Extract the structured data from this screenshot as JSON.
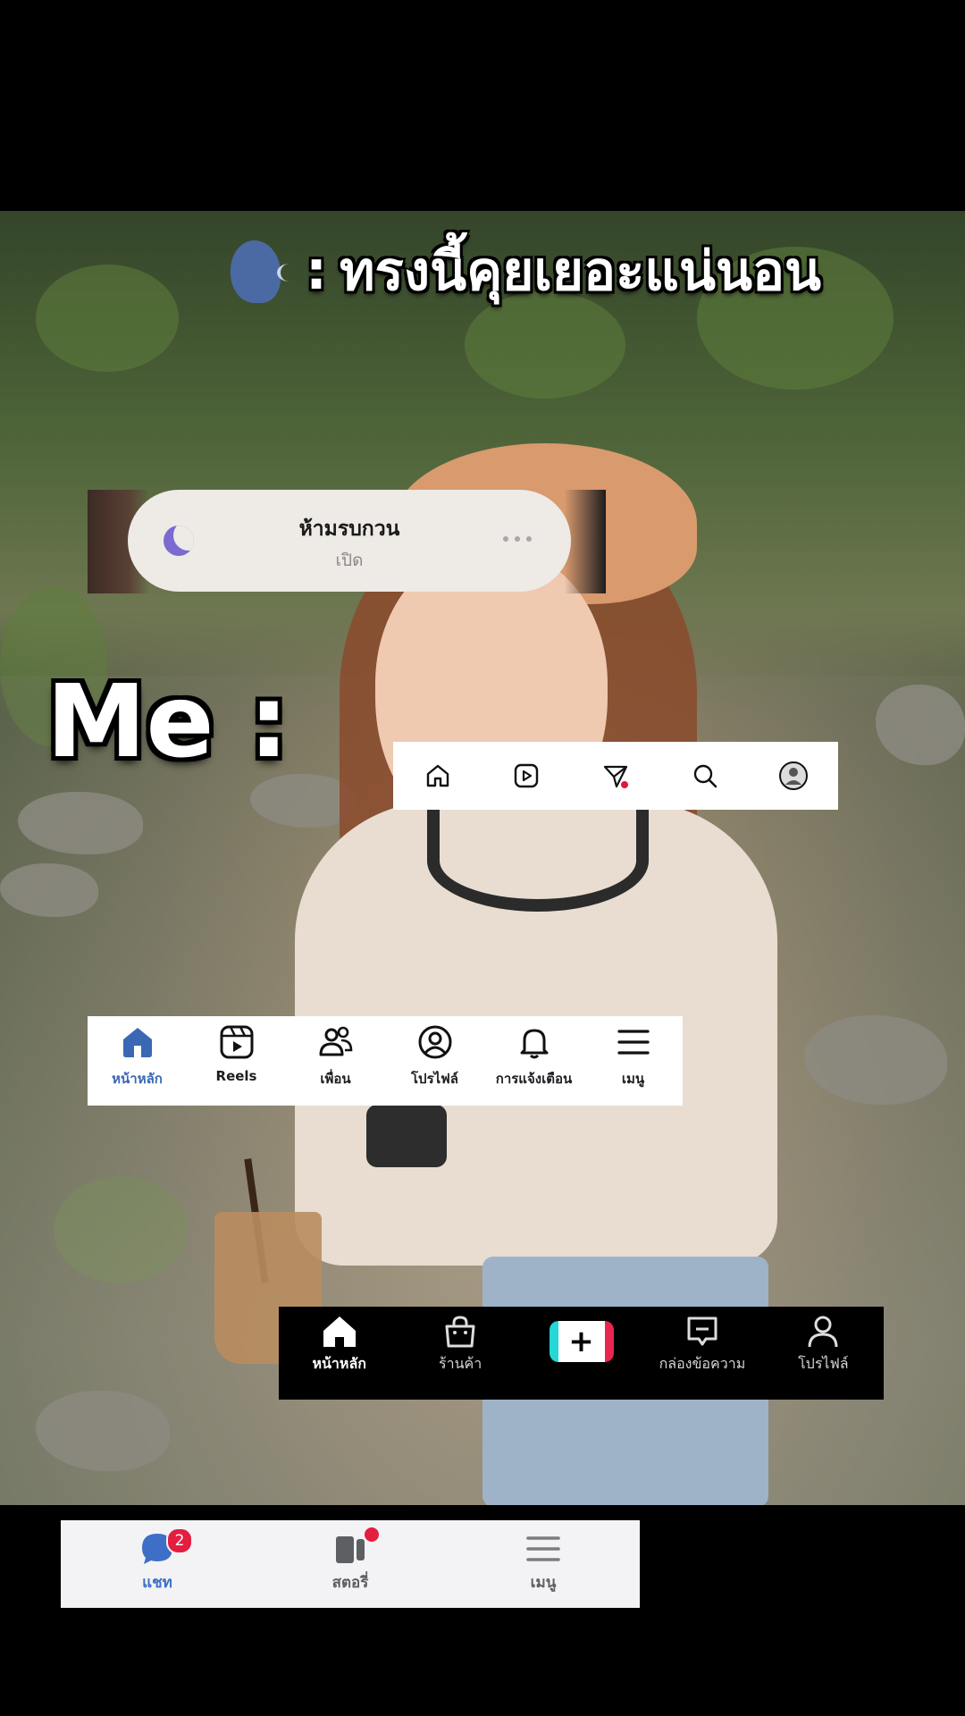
{
  "caption": {
    "text": "ทรงนี้คุยเยอะแน่นอน",
    "icon": "speaking-head-icon"
  },
  "me_label": "Me :",
  "dnd": {
    "title": "ห้ามรบกวน",
    "status": "เปิด",
    "icon": "moon-icon"
  },
  "instagram": {
    "items": [
      {
        "icon": "home-icon"
      },
      {
        "icon": "reels-icon"
      },
      {
        "icon": "send-icon",
        "has_dot": true
      },
      {
        "icon": "search-icon"
      },
      {
        "icon": "profile-icon"
      }
    ]
  },
  "facebook": {
    "accent": "#3a68b5",
    "items": [
      {
        "label": "หน้าหลัก",
        "icon": "home-icon",
        "active": true
      },
      {
        "label": "Reels",
        "icon": "reels-icon"
      },
      {
        "label": "เพื่อน",
        "icon": "friends-icon"
      },
      {
        "label": "โปรไฟล์",
        "icon": "profile-icon"
      },
      {
        "label": "การแจ้งเตือน",
        "icon": "bell-icon"
      },
      {
        "label": "เมนู",
        "icon": "menu-icon"
      }
    ]
  },
  "tiktok": {
    "items": [
      {
        "label": "หน้าหลัก",
        "icon": "home-icon",
        "active": true
      },
      {
        "label": "ร้านค้า",
        "icon": "shop-icon"
      },
      {
        "label": "",
        "icon": "create-plus-icon"
      },
      {
        "label": "กล่องข้อความ",
        "icon": "inbox-icon"
      },
      {
        "label": "โปรไฟล์",
        "icon": "profile-icon"
      }
    ]
  },
  "messenger": {
    "accent": "#3d6fc6",
    "items": [
      {
        "label": "แชท",
        "icon": "chat-icon",
        "badge": "2",
        "active": true
      },
      {
        "label": "สตอรี่",
        "icon": "stories-icon",
        "has_dot": true
      },
      {
        "label": "เมนู",
        "icon": "menu-icon"
      }
    ]
  }
}
